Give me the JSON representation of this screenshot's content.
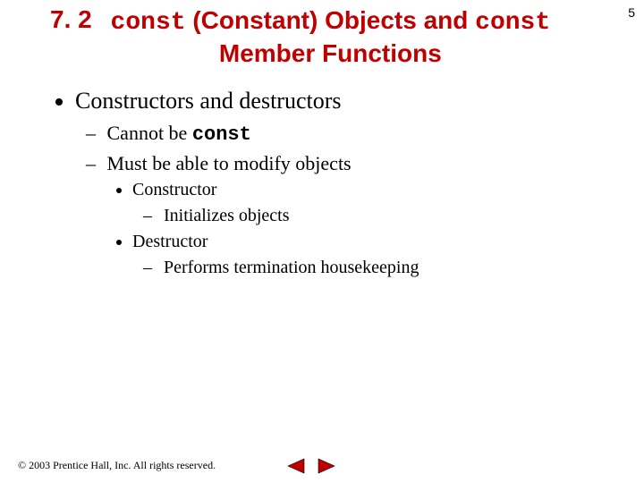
{
  "page_number": "5",
  "title": {
    "section": "7. 2",
    "line1_pre": "const",
    "line1_mid": " (Constant) Objects and ",
    "line1_post": "const",
    "line2": "Member Functions"
  },
  "bullets": {
    "l1a": "Constructors and destructors",
    "l2a_pre": "Cannot be ",
    "l2a_code": "const",
    "l2b": "Must be able to modify objects",
    "l3a": "Constructor",
    "l4a": "Initializes objects",
    "l3b": "Destructor",
    "l4b": "Performs termination housekeeping"
  },
  "footer": "© 2003 Prentice Hall, Inc.  All rights reserved.",
  "nav": {
    "prev_color": "#c00000",
    "next_color": "#c00000"
  }
}
